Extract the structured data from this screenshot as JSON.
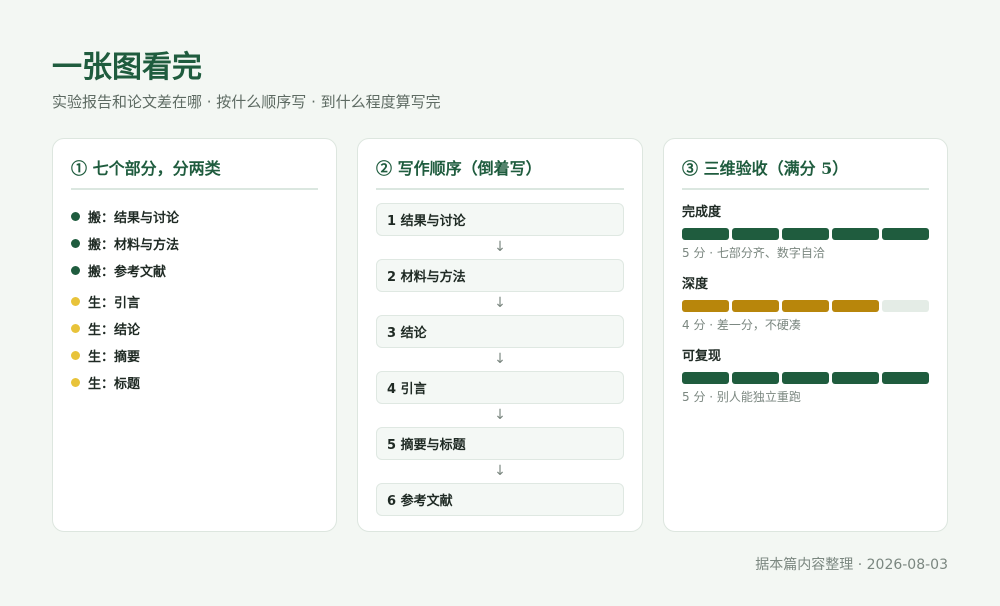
{
  "header": {
    "title": "一张图看完",
    "subtitle": "实验报告和论文差在哪 · 按什么顺序写 · 到什么程度算写完"
  },
  "colors": {
    "accent": "#1f5c3e",
    "move_dot": "#1f5c3e",
    "new_dot": "#e8c33a",
    "score_green": "#1f5c3e",
    "score_amber": "#b8860b",
    "score_empty": "#e4ece6"
  },
  "card1": {
    "heading": "① 七个部分，分两类",
    "items": [
      {
        "label": "搬：结果与讨论",
        "kind": "move"
      },
      {
        "label": "搬：材料与方法",
        "kind": "move"
      },
      {
        "label": "搬：参考文献",
        "kind": "move"
      },
      {
        "label": "生：引言",
        "kind": "new"
      },
      {
        "label": "生：结论",
        "kind": "new"
      },
      {
        "label": "生：摘要",
        "kind": "new"
      },
      {
        "label": "生：标题",
        "kind": "new"
      }
    ]
  },
  "card2": {
    "heading": "② 写作顺序（倒着写）",
    "arrow": "↓",
    "steps": [
      "1 结果与讨论",
      "2 材料与方法",
      "3 结论",
      "4 引言",
      "5 摘要与标题",
      "6 参考文献"
    ]
  },
  "card3": {
    "heading": "③ 三维验收（满分 5）",
    "metrics": [
      {
        "label": "完成度",
        "score": 5,
        "max": 5,
        "color": "#1f5c3e",
        "note": "5 分 · 七部分齐、数字自洽"
      },
      {
        "label": "深度",
        "score": 4,
        "max": 5,
        "color": "#b8860b",
        "note": "4 分 · 差一分，不硬凑"
      },
      {
        "label": "可复现",
        "score": 5,
        "max": 5,
        "color": "#1f5c3e",
        "note": "5 分 · 别人能独立重跑"
      }
    ]
  },
  "footer": {
    "text": "据本篇内容整理 · 2026-08-03"
  }
}
